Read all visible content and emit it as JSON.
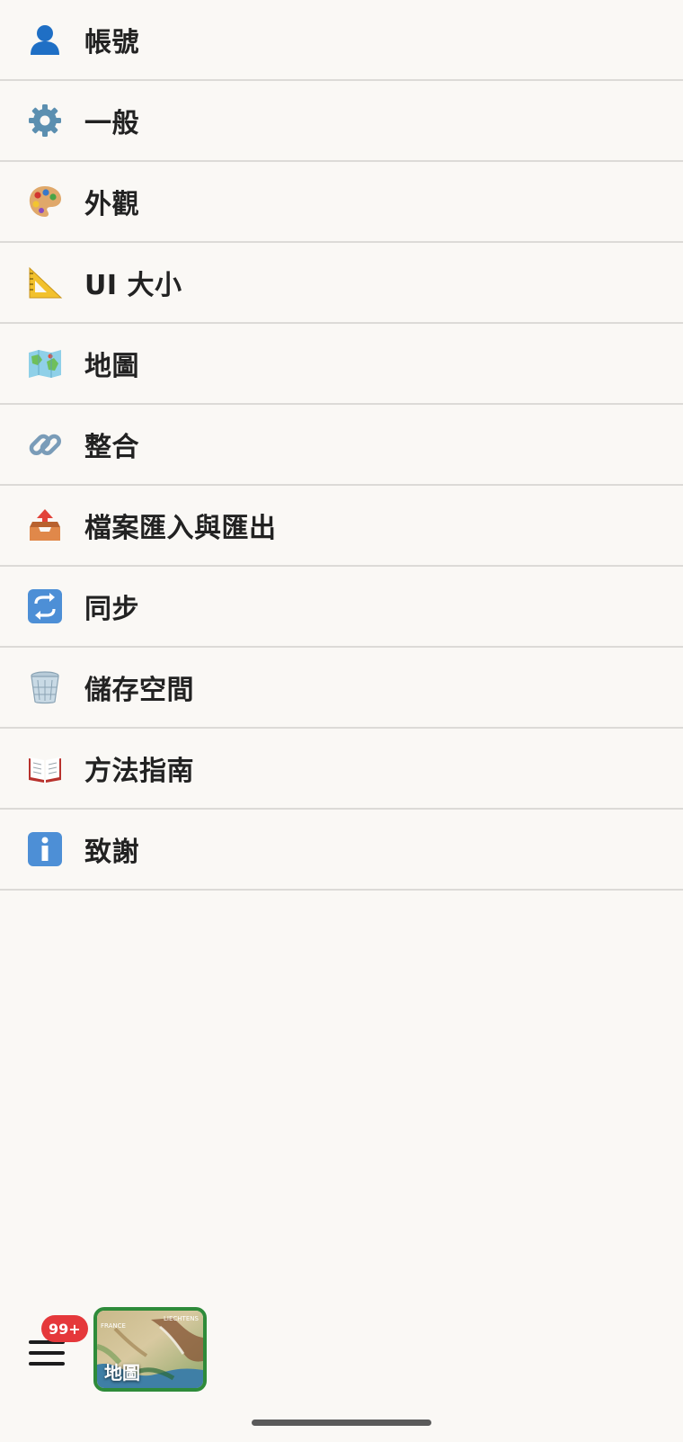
{
  "menu": {
    "items": [
      {
        "label": "帳號",
        "icon": "person-icon"
      },
      {
        "label": "一般",
        "icon": "gear-icon"
      },
      {
        "label": "外觀",
        "icon": "palette-icon"
      },
      {
        "label": "UI 大小",
        "icon": "triangle-ruler-icon"
      },
      {
        "label": "地圖",
        "icon": "map-icon"
      },
      {
        "label": "整合",
        "icon": "link-icon"
      },
      {
        "label": "檔案匯入與匯出",
        "icon": "outbox-tray-icon"
      },
      {
        "label": "同步",
        "icon": "sync-arrows-icon"
      },
      {
        "label": "儲存空間",
        "icon": "wastebasket-icon"
      },
      {
        "label": "方法指南",
        "icon": "open-book-icon"
      },
      {
        "label": "致謝",
        "icon": "info-icon"
      }
    ]
  },
  "bottom_bar": {
    "badge": "99+",
    "map_tile": {
      "label": "地圖",
      "region_label_left": "FRANCE",
      "region_label_right": "LIECHTENS"
    }
  },
  "colors": {
    "background": "#faf8f5",
    "divider": "#dcdad7",
    "badge": "#e5383b",
    "map_border": "#2e8b3a"
  }
}
